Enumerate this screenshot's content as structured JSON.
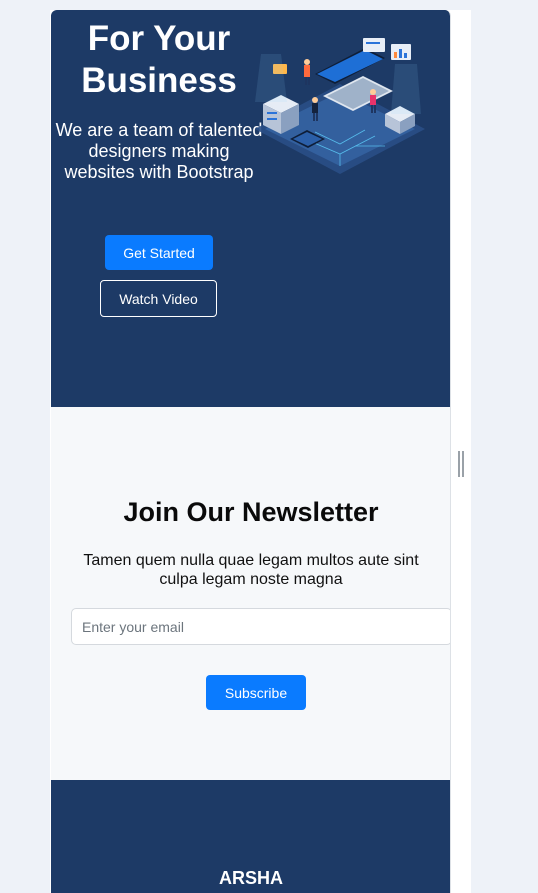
{
  "hero": {
    "title": "For Your Business",
    "subtitle": "We are a team of talented designers making websites with Bootstrap",
    "primary_button": "Get Started",
    "secondary_button": "Watch Video",
    "illustration_icon": "isometric-tech-illustration"
  },
  "newsletter": {
    "title": "Join Our Newsletter",
    "text": "Tamen quem nulla quae legam multos aute sint culpa legam noste magna",
    "email_placeholder": "Enter your email",
    "email_value": "",
    "subscribe_button": "Subscribe"
  },
  "footer": {
    "brand": "ARSHA"
  },
  "colors": {
    "hero_bg": "#1d3a66",
    "accent": "#0a7bff",
    "section_bg": "#f6f8fa",
    "page_bg": "#eef2f8"
  }
}
